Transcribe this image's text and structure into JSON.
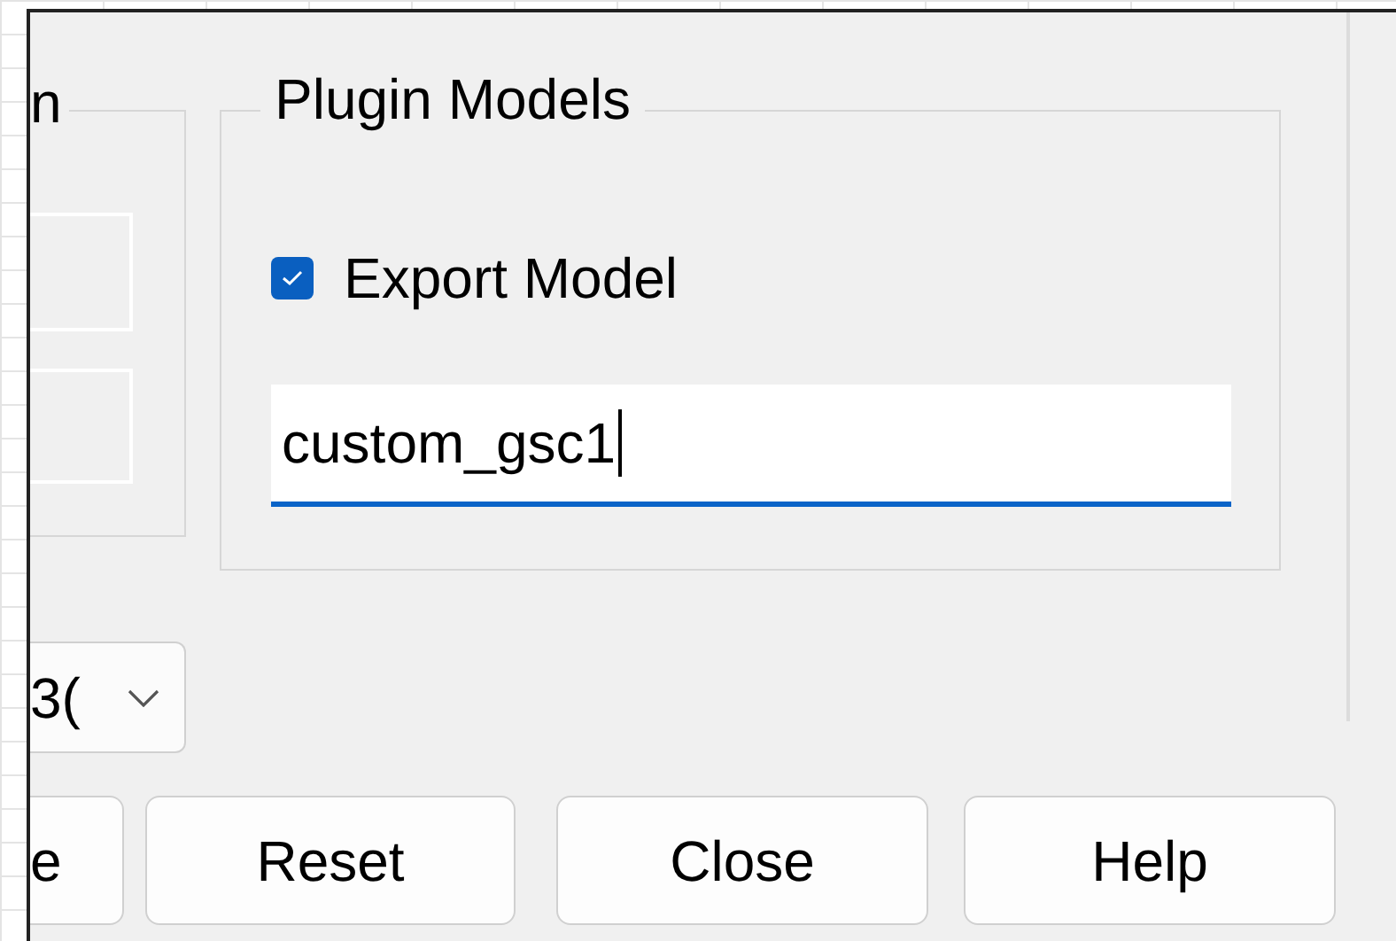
{
  "left_group": {
    "title": "n"
  },
  "plugin_models": {
    "title": "Plugin Models",
    "export_model": {
      "label": "Export Model",
      "checked": true
    },
    "model_name": {
      "value": "custom_gsc1",
      "focused": true
    }
  },
  "combo": {
    "value": "3("
  },
  "buttons": [
    {
      "label": "e"
    },
    {
      "label": "Reset"
    },
    {
      "label": "Close"
    },
    {
      "label": "Help"
    }
  ]
}
